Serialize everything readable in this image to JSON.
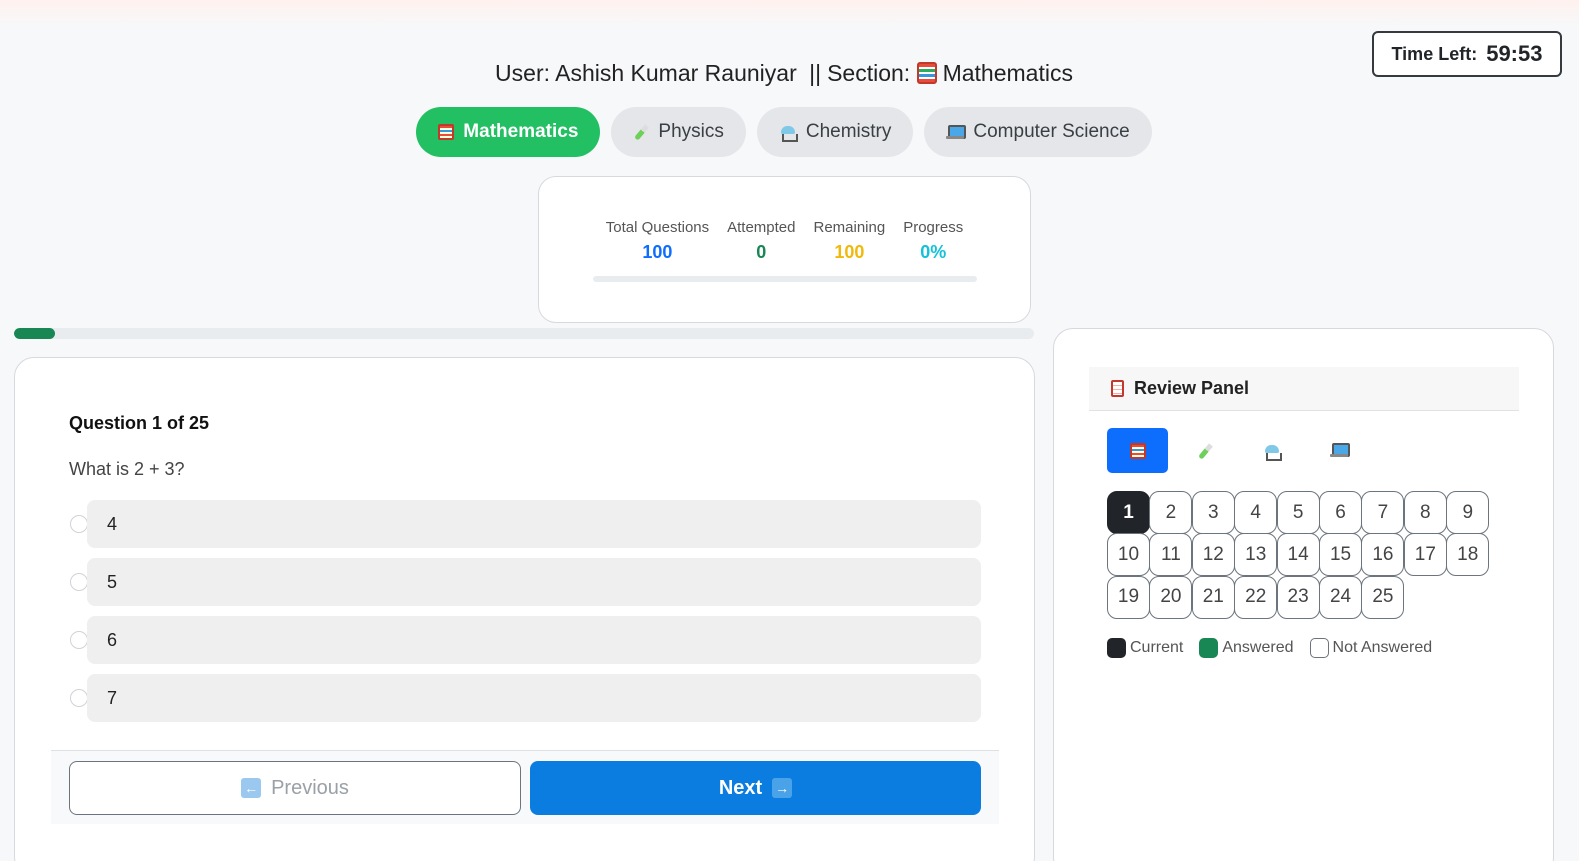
{
  "timer": {
    "label": "Time Left:",
    "value": "59:53"
  },
  "header": {
    "user_prefix": "User:",
    "user_name": "Ashish Kumar Rauniyar",
    "separator": "||",
    "section_prefix": "Section:",
    "section_name": "Mathematics"
  },
  "tabs": [
    {
      "label": "Mathematics",
      "icon": "abacus-icon",
      "active": true
    },
    {
      "label": "Physics",
      "icon": "test-tube-icon",
      "active": false
    },
    {
      "label": "Chemistry",
      "icon": "distillery-icon",
      "active": false
    },
    {
      "label": "Computer Science",
      "icon": "laptop-icon",
      "active": false
    }
  ],
  "stats": {
    "total_label": "Total Questions",
    "total_value": "100",
    "attempted_label": "Attempted",
    "attempted_value": "0",
    "remaining_label": "Remaining",
    "remaining_value": "100",
    "progress_label": "Progress",
    "progress_value": "0%",
    "progress_fraction": 0
  },
  "section_progress_fraction": 0.04,
  "question": {
    "counter": "Question 1 of 25",
    "text": "What is 2 + 3?",
    "options": [
      "4",
      "5",
      "6",
      "7"
    ]
  },
  "nav": {
    "previous_label": "Previous",
    "next_label": "Next"
  },
  "review": {
    "title": "Review Panel",
    "subjects": [
      "abacus-icon",
      "test-tube-icon",
      "distillery-icon",
      "laptop-icon"
    ],
    "numbers": [
      "1",
      "2",
      "3",
      "4",
      "5",
      "6",
      "7",
      "8",
      "9",
      "10",
      "11",
      "12",
      "13",
      "14",
      "15",
      "16",
      "17",
      "18",
      "19",
      "20",
      "21",
      "22",
      "23",
      "24",
      "25"
    ],
    "current": "1",
    "legend": {
      "current": "Current",
      "answered": "Answered",
      "not_answered": "Not Answered"
    }
  },
  "colors": {
    "active_tab": "#22c063",
    "next_button": "#0b7de0",
    "answered": "#198754",
    "current": "#212529"
  }
}
